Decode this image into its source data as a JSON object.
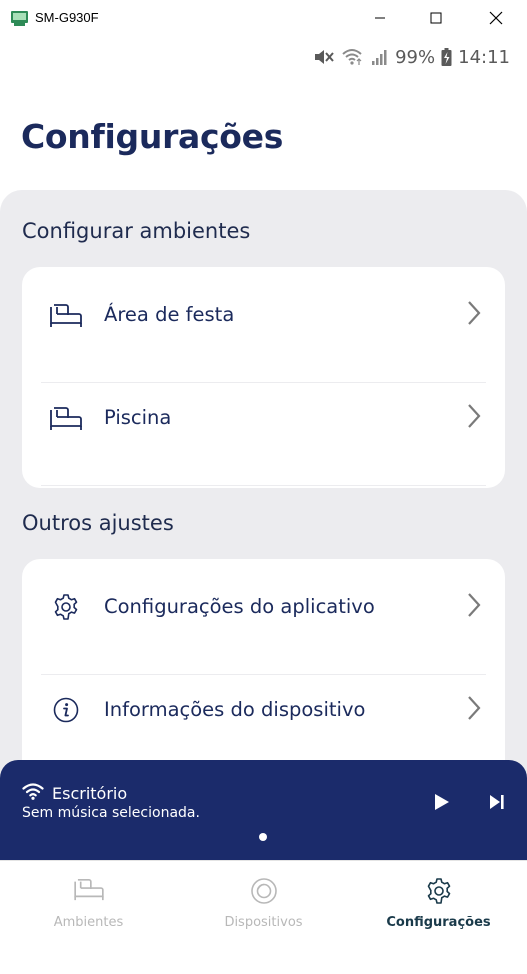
{
  "window": {
    "title": "SM-G930F"
  },
  "status": {
    "battery": "99%",
    "time": "14:11"
  },
  "page": {
    "title": "Configurações"
  },
  "sections": {
    "ambientes": {
      "label": "Configurar ambientes",
      "items": [
        {
          "label": "Área de festa",
          "icon": "sofa-icon"
        },
        {
          "label": "Piscina",
          "icon": "sofa-icon"
        }
      ]
    },
    "outros": {
      "label": "Outros ajustes",
      "items": [
        {
          "label": "Configurações do aplicativo",
          "icon": "gear-icon"
        },
        {
          "label": "Informações do dispositivo",
          "icon": "info-icon"
        }
      ]
    }
  },
  "player": {
    "room": "Escritório",
    "status": "Sem música selecionada."
  },
  "tabs": [
    {
      "label": "Ambientes",
      "icon": "sofa-icon",
      "active": false
    },
    {
      "label": "Dispositivos",
      "icon": "speaker-icon",
      "active": false
    },
    {
      "label": "Configurações",
      "icon": "gear-icon",
      "active": true
    }
  ],
  "colors": {
    "primary": "#1b2a5c",
    "player_bg": "#1b2b6b",
    "active_tab": "#1a3a4a",
    "inactive_tab": "#b8b8b8",
    "panel_bg": "#ececef"
  }
}
